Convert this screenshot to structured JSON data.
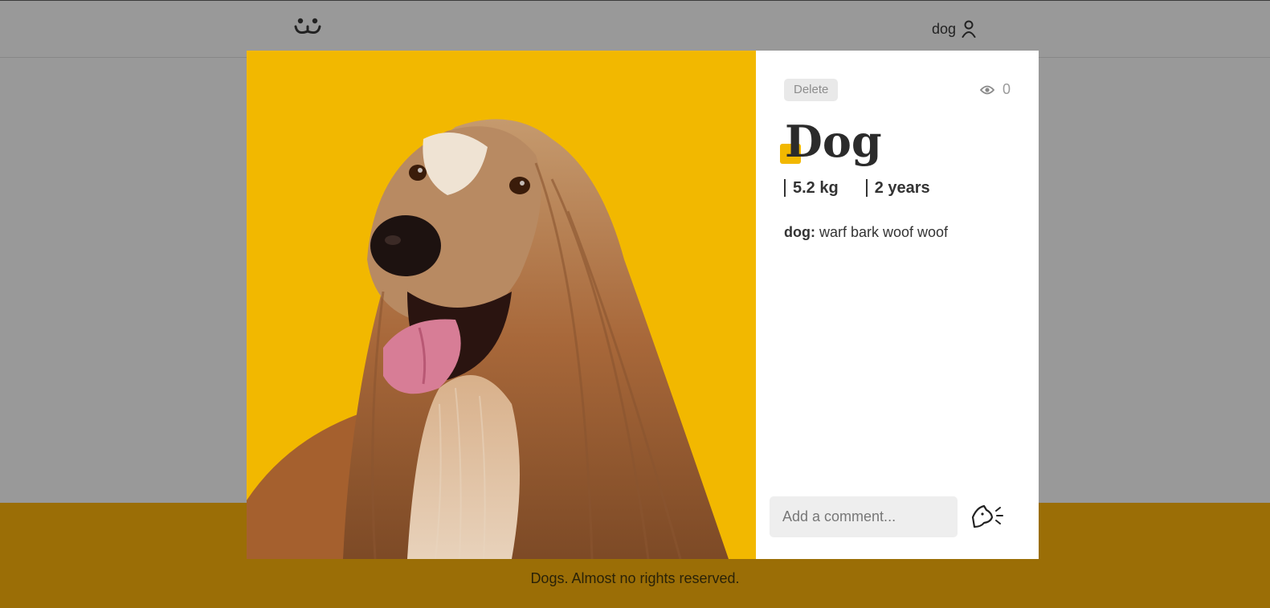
{
  "header": {
    "logo_icon": "dog-face-icon",
    "login_label": "dog",
    "user_icon": "user-icon"
  },
  "photo": {
    "subject": "long-haired dog on yellow background",
    "background_color": "#f2b800"
  },
  "details": {
    "delete_label": "Delete",
    "views_icon": "eye-icon",
    "views_count": "0",
    "title": "Dog",
    "weight": "5.2 kg",
    "age": "2 years",
    "comment_author": "dog:",
    "comment_text": " warf bark woof woof",
    "comment_placeholder": "Add a comment...",
    "send_icon": "barking-dog-icon"
  },
  "footer": {
    "text": "Dogs. Almost no rights reserved."
  },
  "colors": {
    "accent": "#f2b800",
    "footer": "#9b6e06",
    "overlay": "#999999"
  }
}
